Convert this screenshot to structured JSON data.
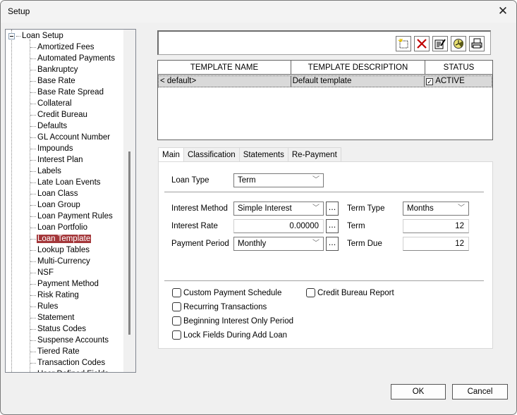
{
  "window": {
    "title": "Setup"
  },
  "tree": {
    "root": "Loan Setup",
    "items": [
      "Amortized Fees",
      "Automated Payments",
      "Bankruptcy",
      "Base Rate",
      "Base Rate Spread",
      "Collateral",
      "Credit Bureau",
      "Defaults",
      "GL Account Number",
      "Impounds",
      "Interest Plan",
      "Labels",
      "Late Loan Events",
      "Loan Class",
      "Loan Group",
      "Loan Payment Rules",
      "Loan Portfolio",
      "Loan Template",
      "Lookup Tables",
      "Multi-Currency",
      "NSF",
      "Payment Method",
      "Risk Rating",
      "Rules",
      "Statement",
      "Status Codes",
      "Suspense Accounts",
      "Tiered Rate",
      "Transaction Codes",
      "User Defined Fields"
    ],
    "selected": "Loan Template"
  },
  "toolbar": {
    "buttons": [
      "new-icon",
      "delete-icon",
      "edit-icon",
      "refresh-icon",
      "print-icon"
    ]
  },
  "grid": {
    "columns": [
      "TEMPLATE NAME",
      "TEMPLATE DESCRIPTION",
      "STATUS"
    ],
    "rows": [
      {
        "name": "< default>",
        "description": "Default template",
        "status": "ACTIVE",
        "checked": true
      }
    ]
  },
  "tabs": [
    "Main",
    "Classification",
    "Statements",
    "Re-Payment"
  ],
  "form": {
    "loan_type_label": "Loan Type",
    "loan_type_value": "Term",
    "interest_method_label": "Interest Method",
    "interest_method_value": "Simple Interest",
    "interest_rate_label": "Interest Rate",
    "interest_rate_value": "0.00000",
    "payment_period_label": "Payment Period",
    "payment_period_value": "Monthly",
    "term_type_label": "Term Type",
    "term_type_value": "Months",
    "term_label": "Term",
    "term_value": "12",
    "term_due_label": "Term Due",
    "term_due_value": "12",
    "ellipsis": "..."
  },
  "checkboxes": {
    "custom_payment_schedule": "Custom Payment Schedule",
    "credit_bureau_report": "Credit Bureau Report",
    "recurring_transactions": "Recurring Transactions",
    "beginning_interest_only": "Beginning Interest Only Period",
    "lock_fields": "Lock Fields During Add Loan"
  },
  "buttons": {
    "ok": "OK",
    "cancel": "Cancel"
  }
}
